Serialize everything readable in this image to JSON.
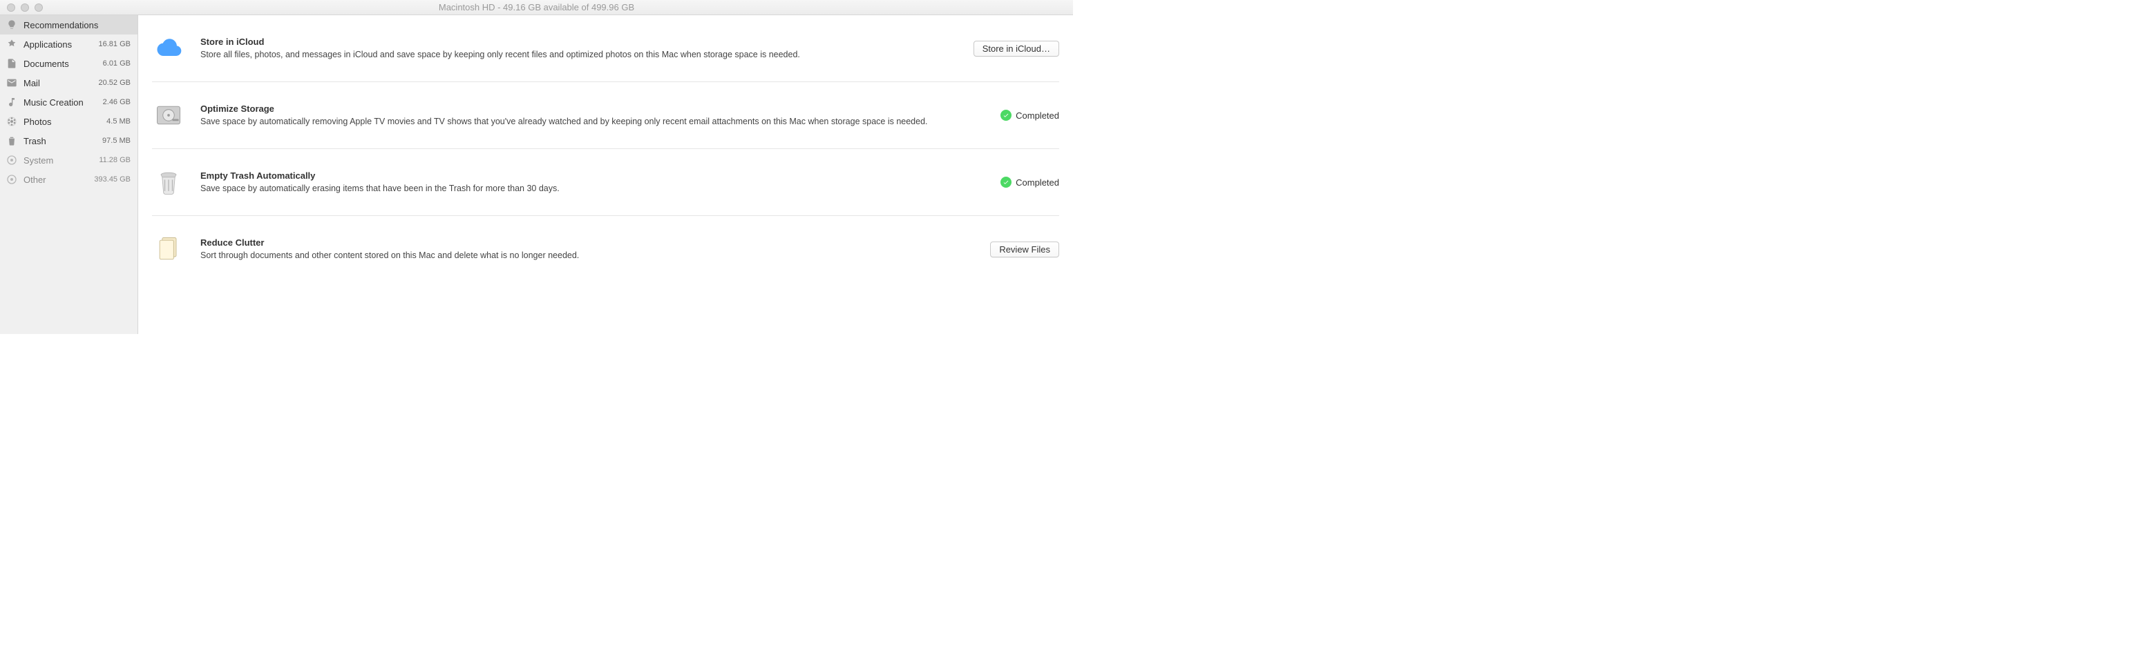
{
  "window": {
    "title": "Macintosh HD - 49.16 GB available of 499.96 GB"
  },
  "sidebar": {
    "items": [
      {
        "label": "Recommendations",
        "size": ""
      },
      {
        "label": "Applications",
        "size": "16.81 GB"
      },
      {
        "label": "Documents",
        "size": "6.01 GB"
      },
      {
        "label": "Mail",
        "size": "20.52 GB"
      },
      {
        "label": "Music Creation",
        "size": "2.46 GB"
      },
      {
        "label": "Photos",
        "size": "4.5 MB"
      },
      {
        "label": "Trash",
        "size": "97.5 MB"
      },
      {
        "label": "System",
        "size": "11.28 GB"
      },
      {
        "label": "Other",
        "size": "393.45 GB"
      }
    ]
  },
  "recommendations": [
    {
      "title": "Store in iCloud",
      "desc": "Store all files, photos, and messages in iCloud and save space by keeping only recent files and optimized photos on this Mac when storage space is needed.",
      "action_label": "Store in iCloud…"
    },
    {
      "title": "Optimize Storage",
      "desc": "Save space by automatically removing Apple TV movies and TV shows that you've already watched and by keeping only recent email attachments on this Mac when storage space is needed.",
      "status_label": "Completed"
    },
    {
      "title": "Empty Trash Automatically",
      "desc": "Save space by automatically erasing items that have been in the Trash for more than 30 days.",
      "status_label": "Completed"
    },
    {
      "title": "Reduce Clutter",
      "desc": "Sort through documents and other content stored on this Mac and delete what is no longer needed.",
      "action_label": "Review Files"
    }
  ]
}
